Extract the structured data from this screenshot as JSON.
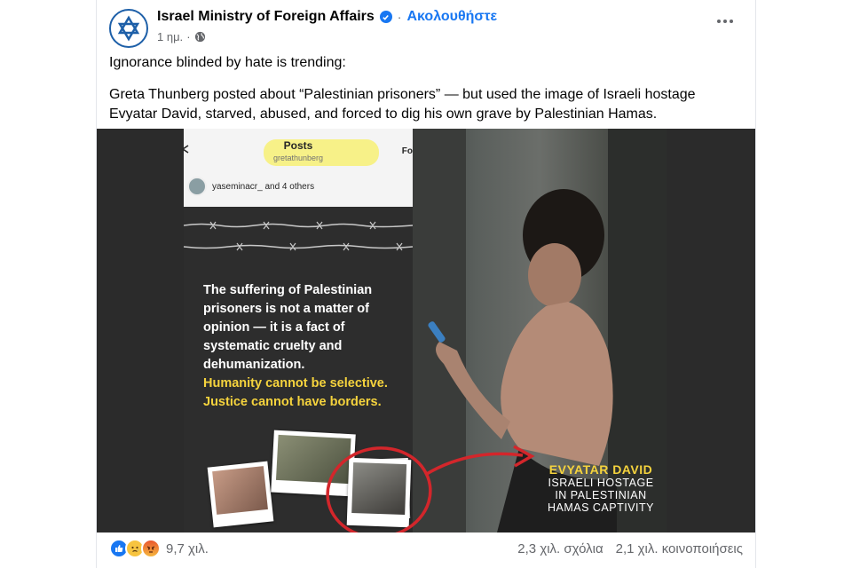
{
  "post": {
    "author": "Israel Ministry of Foreign Affairs",
    "follow_label": "Ακολουθήστε",
    "separator": "·",
    "time": "1 ημ.",
    "meta_sep": "·",
    "paragraph1": "Ignorance blinded by hate is trending:",
    "paragraph2": "Greta Thunberg posted about “Palestinian prisoners” — but used the image of Israeli hostage Evyatar David, starved, abused, and forced to dig his own grave by Palestinian Hamas."
  },
  "image": {
    "ig_title": "Posts",
    "ig_handle": "gretathunberg",
    "ig_follow": "Fo",
    "ig_liked": "yaseminacr_ and 4 others",
    "quote_white": "The suffering of Palestinian prisoners is not a matter of opinion — it is a fact of systematic cruelty and dehumanization.",
    "quote_yellow1": "Humanity cannot be selective.",
    "quote_yellow2": "Justice cannot have borders.",
    "caption_name": "EVYATAR DAVID",
    "caption_line1": "ISRAELI HOSTAGE",
    "caption_line2": "IN PALESTINIAN",
    "caption_line3": "HAMAS CAPTIVITY"
  },
  "footer": {
    "reaction_count": "9,7 χιλ.",
    "comments": "2,3 χιλ. σχόλια",
    "shares": "2,1 χιλ. κοινοποιήσεις"
  },
  "colors": {
    "accent": "#1877f2",
    "highlight_yellow": "#f5d33d",
    "arrow_red": "#d3262b",
    "secondary_text": "#65676b"
  },
  "icons": [
    "star-of-david-icon",
    "verified-badge-icon",
    "globe-icon",
    "more-options-icon",
    "like-reaction-icon",
    "sad-reaction-icon",
    "angry-reaction-icon",
    "barbed-wire-icon",
    "red-arrow-icon"
  ]
}
